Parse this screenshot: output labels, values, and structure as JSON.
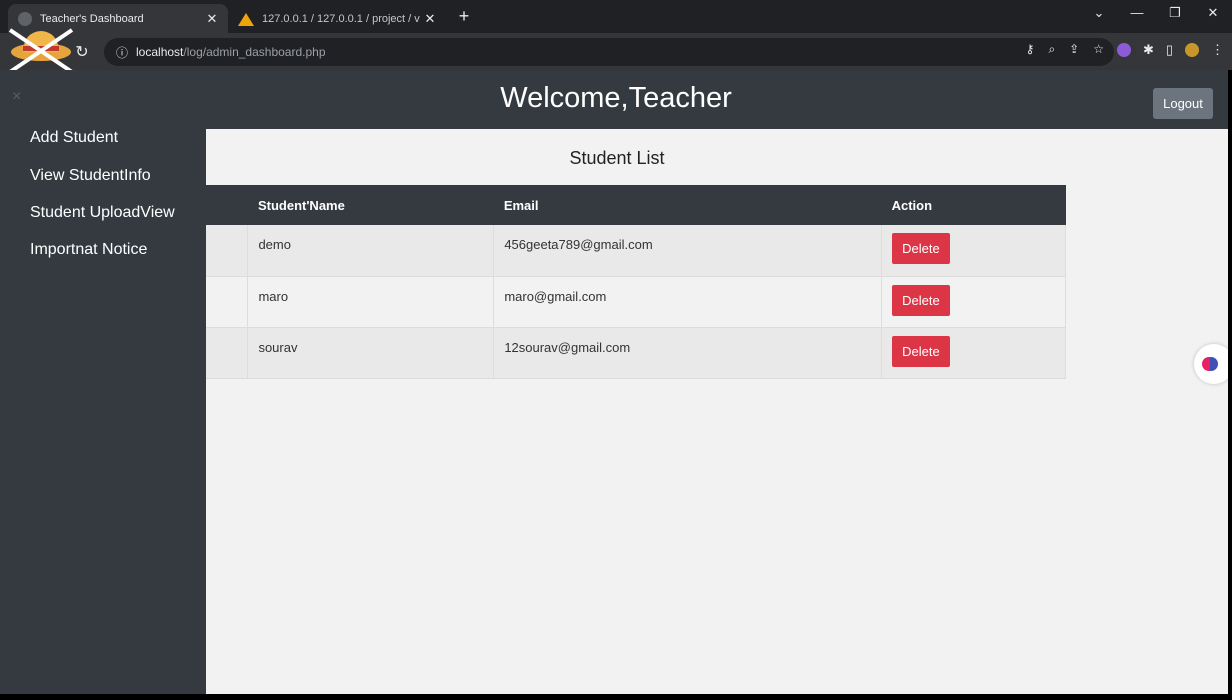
{
  "browser": {
    "tabs": [
      {
        "title": "Teacher's Dashboard",
        "active": true
      },
      {
        "title": "127.0.0.1 / 127.0.0.1 / project / v",
        "active": false
      }
    ],
    "url_host": "localhost",
    "url_path": "/log/admin_dashboard.php"
  },
  "header": {
    "title": "Welcome,Teacher",
    "logout_label": "Logout",
    "close_glyph": "×"
  },
  "sidebar": {
    "items": [
      {
        "label": "Add Student"
      },
      {
        "label": "View StudentInfo"
      },
      {
        "label": "Student UploadView"
      },
      {
        "label": "Importnat Notice"
      }
    ]
  },
  "main": {
    "title": "Student List",
    "table": {
      "headers": [
        "",
        "Student'Name",
        "Email",
        "Action"
      ],
      "rows": [
        {
          "name": "demo",
          "email": "456geeta789@gmail.com",
          "action": "Delete"
        },
        {
          "name": "maro",
          "email": "maro@gmail.com",
          "action": "Delete"
        },
        {
          "name": "sourav",
          "email": "12sourav@gmail.com",
          "action": "Delete"
        }
      ]
    }
  },
  "colors": {
    "header_bg": "#343a40",
    "delete_btn": "#dc3545",
    "logout_btn": "#6c757d",
    "page_bg": "#f2f2f2"
  }
}
